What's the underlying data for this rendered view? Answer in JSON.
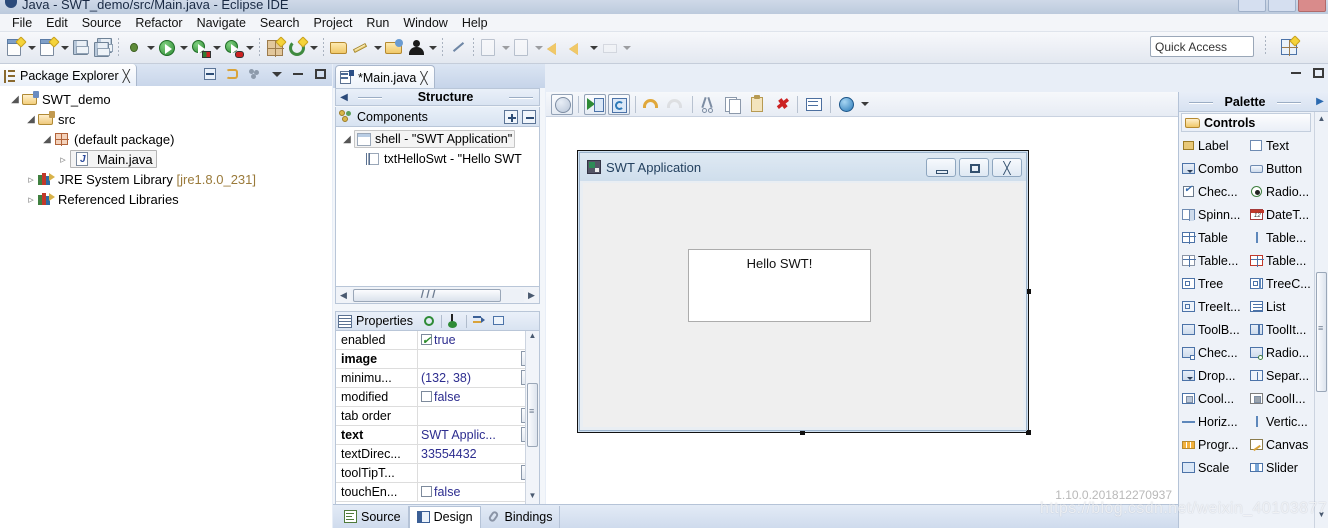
{
  "window": {
    "title": "Java - SWT_demo/src/Main.java - Eclipse IDE",
    "app_icon": "eclipse-icon",
    "buttons": [
      "minimize",
      "maximize",
      "close"
    ]
  },
  "menubar": {
    "items": [
      "File",
      "Edit",
      "Source",
      "Refactor",
      "Navigate",
      "Search",
      "Project",
      "Run",
      "Window",
      "Help"
    ]
  },
  "toolbar": {
    "groups": [
      {
        "items": [
          {
            "icon": "new-wizard-icon",
            "caret": true
          },
          {
            "icon": "new-java-class-icon",
            "caret": true
          },
          {
            "icon": "save-icon",
            "caret": false
          },
          {
            "icon": "save-all-icon",
            "caret": false
          }
        ]
      },
      {
        "items": [
          {
            "icon": "debug-icon",
            "caret": true
          },
          {
            "icon": "run-icon",
            "caret": true
          },
          {
            "icon": "run-external-tools-icon",
            "caret": true
          },
          {
            "icon": "coverage-icon",
            "caret": true
          }
        ]
      },
      {
        "items": [
          {
            "icon": "new-package-icon",
            "caret": false
          },
          {
            "icon": "refresh-icon",
            "caret": true
          }
        ]
      },
      {
        "items": [
          {
            "icon": "open-type-icon",
            "caret": false
          },
          {
            "icon": "search-pencil-icon",
            "caret": true
          },
          {
            "icon": "open-task-icon",
            "caret": false
          },
          {
            "icon": "user-icon",
            "caret": true
          }
        ]
      },
      {
        "items": [
          {
            "icon": "skip-breakpoints-icon",
            "caret": false
          }
        ]
      },
      {
        "items": [
          {
            "icon": "next-annotation-icon",
            "caret": true
          },
          {
            "icon": "previous-annotation-icon",
            "caret": true
          }
        ]
      },
      {
        "items": [
          {
            "icon": "last-edit-location-icon",
            "caret": false
          },
          {
            "icon": "back-icon",
            "caret": true
          },
          {
            "icon": "forward-icon",
            "caret": true
          }
        ]
      }
    ],
    "quick_access_placeholder": "Quick Access",
    "perspective_icon": "open-perspective-icon"
  },
  "package_explorer": {
    "tab_label": "Package Explorer",
    "tab_icon": "package-explorer-icon",
    "close_icon": "close-icon",
    "tools": [
      "collapse-all-icon",
      "link-with-editor-icon",
      "view-menu-dots-icon",
      "view-menu-icon",
      "minimize-icon",
      "maximize-icon"
    ],
    "tree": [
      {
        "label": "SWT_demo",
        "icon": "java-project-icon",
        "indent": 0,
        "twisty": "open",
        "selected": false
      },
      {
        "label": "src",
        "icon": "source-folder-icon",
        "indent": 1,
        "twisty": "open",
        "selected": false
      },
      {
        "label": "(default package)",
        "icon": "package-icon",
        "indent": 2,
        "twisty": "open",
        "selected": false
      },
      {
        "label": "Main.java",
        "icon": "java-file-icon",
        "indent": 3,
        "twisty": "closed",
        "selected": true
      },
      {
        "label": "JRE System Library",
        "suffix": "[jre1.8.0_231]",
        "icon": "library-icon",
        "indent": 1,
        "twisty": "closed",
        "selected": false
      },
      {
        "label": "Referenced Libraries",
        "icon": "library-icon",
        "indent": 1,
        "twisty": "closed",
        "selected": false
      }
    ]
  },
  "editor": {
    "tab_label": "*Main.java",
    "tab_icon": "java-editor-icon",
    "close_icon": "close-icon",
    "minimize_icon": "minimize-icon",
    "maximize_icon": "maximize-icon",
    "bottom_tabs": [
      {
        "label": "Source",
        "icon": "source-tab-icon",
        "active": false
      },
      {
        "label": "Design",
        "icon": "design-tab-icon",
        "active": true
      },
      {
        "label": "Bindings",
        "icon": "bindings-tab-icon",
        "active": false
      }
    ]
  },
  "structure": {
    "title": "Structure",
    "collapse_arrow": "left-arrow-icon",
    "components_label": "Components",
    "components_icon": "components-icon",
    "expand_button": "expand-all-icon",
    "collapse_button": "collapse-all-icon",
    "tree": [
      {
        "label": "shell - \"SWT Application\"",
        "icon": "shell-icon",
        "indent": 0,
        "twisty": "open",
        "selected": true
      },
      {
        "label": "txtHelloSwt - \"Hello SWT",
        "icon": "text-widget-icon",
        "indent": 1,
        "twisty": "none",
        "selected": false
      }
    ]
  },
  "properties": {
    "title": "Properties",
    "icon": "properties-icon",
    "tools": [
      "show-events-icon",
      "goto-definition-icon",
      "show-advanced-icon",
      "restore-defaults-icon"
    ],
    "columns": [
      "name",
      "value"
    ],
    "rows": [
      {
        "name": "enabled",
        "bold": false,
        "value": "true",
        "widget": "checkbox-checked",
        "dots": false
      },
      {
        "name": "image",
        "bold": true,
        "value": "",
        "widget": "none",
        "dots": true
      },
      {
        "name": "minimu...",
        "bold": false,
        "value": "(132, 38)",
        "widget": "none",
        "dots": true
      },
      {
        "name": "modified",
        "bold": false,
        "value": "false",
        "widget": "checkbox",
        "dots": false
      },
      {
        "name": "tab order",
        "bold": false,
        "value": "",
        "widget": "none",
        "dots": true
      },
      {
        "name": "text",
        "bold": true,
        "value": "SWT Applic...",
        "widget": "none",
        "dots": true
      },
      {
        "name": "textDirec...",
        "bold": false,
        "value": "33554432",
        "widget": "none",
        "dots": false
      },
      {
        "name": "toolTipT...",
        "bold": false,
        "value": "",
        "widget": "none",
        "dots": true
      },
      {
        "name": "touchEn...",
        "bold": false,
        "value": "false",
        "widget": "checkbox",
        "dots": false
      }
    ]
  },
  "design_toolbar": {
    "items": [
      {
        "icon": "test-preview-icon",
        "boxed": true
      },
      {
        "icon": "open-in-editor-icon",
        "boxed": true
      },
      {
        "icon": "refresh-design-icon",
        "boxed": true
      },
      {
        "icon": "undo-icon",
        "boxed": false
      },
      {
        "icon": "redo-icon",
        "boxed": false
      },
      {
        "icon": "cut-icon",
        "boxed": false
      },
      {
        "icon": "copy-icon",
        "boxed": false
      },
      {
        "icon": "paste-icon",
        "boxed": false
      },
      {
        "icon": "delete-icon",
        "boxed": false
      },
      {
        "icon": "properties-view-icon",
        "boxed": false
      },
      {
        "icon": "external-browser-icon",
        "boxed": false
      },
      {
        "icon": "chevron-down-icon",
        "boxed": false
      }
    ]
  },
  "design_canvas": {
    "shell": {
      "title": "SWT Application",
      "icon": "swt-app-icon",
      "buttons": [
        {
          "name": "minimize",
          "icon": "minimize-icon"
        },
        {
          "name": "restore",
          "icon": "restore-icon"
        },
        {
          "name": "close",
          "icon": "close-icon"
        }
      ]
    },
    "text_widget": {
      "value": "Hello SWT!"
    },
    "version": "1.10.0.201812270937",
    "watermark": "https://blog.csdn.net/weixin_40103877"
  },
  "palette": {
    "title": "Palette",
    "expand_arrow": "right-arrow-icon",
    "category": "Controls",
    "category_icon": "folder-open-icon",
    "items": [
      {
        "label": "Label",
        "icon": "label-icon"
      },
      {
        "label": "Text",
        "icon": "text-icon"
      },
      {
        "label": "Combo",
        "icon": "combo-icon"
      },
      {
        "label": "Button",
        "icon": "button-icon"
      },
      {
        "label": "Chec...",
        "icon": "checkbox-icon"
      },
      {
        "label": "Radio...",
        "icon": "radio-button-icon"
      },
      {
        "label": "Spinn...",
        "icon": "spinner-icon"
      },
      {
        "label": "DateT...",
        "icon": "datetime-icon"
      },
      {
        "label": "Table",
        "icon": "table-icon"
      },
      {
        "label": "Table...",
        "icon": "table-column-icon"
      },
      {
        "label": "Table...",
        "icon": "table-item-icon"
      },
      {
        "label": "Table...",
        "icon": "table-cursor-icon"
      },
      {
        "label": "Tree",
        "icon": "tree-icon"
      },
      {
        "label": "TreeC...",
        "icon": "tree-column-icon"
      },
      {
        "label": "TreeIt...",
        "icon": "tree-item-icon"
      },
      {
        "label": "List",
        "icon": "list-icon"
      },
      {
        "label": "ToolB...",
        "icon": "toolbar-icon"
      },
      {
        "label": "ToolIt...",
        "icon": "toolitem-icon"
      },
      {
        "label": "Chec...",
        "icon": "toolitem-check-icon"
      },
      {
        "label": "Radio...",
        "icon": "toolitem-radio-icon"
      },
      {
        "label": "Drop...",
        "icon": "toolitem-dropdown-icon"
      },
      {
        "label": "Separ...",
        "icon": "toolitem-separator-icon"
      },
      {
        "label": "Cool...",
        "icon": "coolbar-icon"
      },
      {
        "label": "CoolI...",
        "icon": "coolitem-icon"
      },
      {
        "label": "Horiz...",
        "icon": "horizontal-separator-icon"
      },
      {
        "label": "Vertic...",
        "icon": "vertical-separator-icon"
      },
      {
        "label": "Progr...",
        "icon": "progressbar-icon"
      },
      {
        "label": "Canvas",
        "icon": "canvas-icon"
      },
      {
        "label": "Scale",
        "icon": "scale-icon"
      },
      {
        "label": "Slider",
        "icon": "slider-icon"
      }
    ]
  }
}
